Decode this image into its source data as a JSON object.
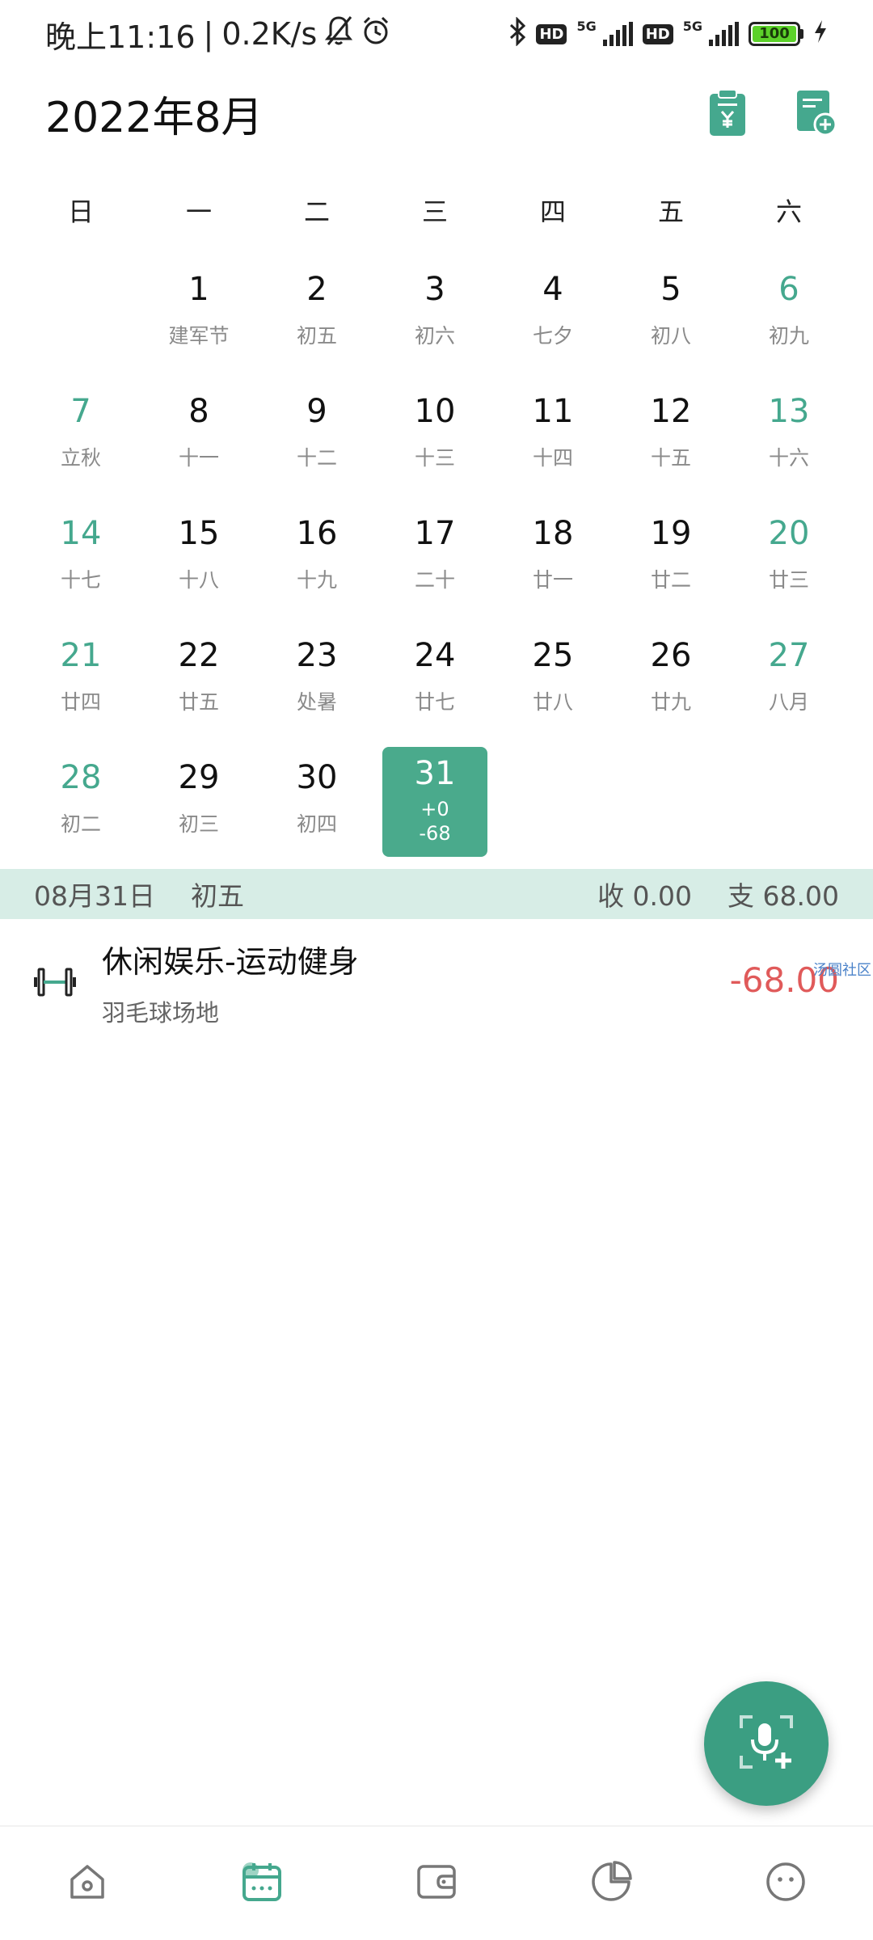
{
  "status_bar": {
    "time": "晚上11:16",
    "separator": "|",
    "net_speed": "0.2K/s",
    "battery": "100",
    "hd1": "HD",
    "hd2": "HD",
    "net1": "5G",
    "net2": "5G"
  },
  "header": {
    "title": "2022年8月",
    "icons": [
      "bill-clipboard-icon",
      "add-record-icon"
    ]
  },
  "weekdays": [
    "日",
    "一",
    "二",
    "三",
    "四",
    "五",
    "六"
  ],
  "calendar": {
    "leading_blank_days": 1,
    "days": [
      {
        "num": "1",
        "sub": "建军节"
      },
      {
        "num": "2",
        "sub": "初五"
      },
      {
        "num": "3",
        "sub": "初六"
      },
      {
        "num": "4",
        "sub": "七夕"
      },
      {
        "num": "5",
        "sub": "初八"
      },
      {
        "num": "6",
        "sub": "初九"
      },
      {
        "num": "7",
        "sub": "立秋"
      },
      {
        "num": "8",
        "sub": "十一"
      },
      {
        "num": "9",
        "sub": "十二"
      },
      {
        "num": "10",
        "sub": "十三"
      },
      {
        "num": "11",
        "sub": "十四"
      },
      {
        "num": "12",
        "sub": "十五"
      },
      {
        "num": "13",
        "sub": "十六"
      },
      {
        "num": "14",
        "sub": "十七"
      },
      {
        "num": "15",
        "sub": "十八"
      },
      {
        "num": "16",
        "sub": "十九"
      },
      {
        "num": "17",
        "sub": "二十"
      },
      {
        "num": "18",
        "sub": "廿一"
      },
      {
        "num": "19",
        "sub": "廿二"
      },
      {
        "num": "20",
        "sub": "廿三"
      },
      {
        "num": "21",
        "sub": "廿四"
      },
      {
        "num": "22",
        "sub": "廿五"
      },
      {
        "num": "23",
        "sub": "处暑"
      },
      {
        "num": "24",
        "sub": "廿七"
      },
      {
        "num": "25",
        "sub": "廿八"
      },
      {
        "num": "26",
        "sub": "廿九"
      },
      {
        "num": "27",
        "sub": "八月"
      },
      {
        "num": "28",
        "sub": "初二"
      },
      {
        "num": "29",
        "sub": "初三"
      },
      {
        "num": "30",
        "sub": "初四"
      },
      {
        "num": "31",
        "sub": "+0\n-68",
        "selected": true
      }
    ],
    "accent_color": "#4aaa8c",
    "weekend_color": "#45a88e"
  },
  "summary": {
    "date": "08月31日",
    "lunar": "初五",
    "income": "收 0.00",
    "expense": "支 68.00"
  },
  "records": [
    {
      "icon": "dumbbell-icon",
      "title": "休闲娱乐-运动健身",
      "note": "羽毛球场地",
      "amount": "-68.00",
      "amount_color": "#e05a5a"
    }
  ],
  "watermark": "汤圆社区",
  "fab": {
    "icon": "voice-add-icon"
  },
  "bottom_nav": [
    {
      "name": "home",
      "icon": "home-icon",
      "active": false
    },
    {
      "name": "calendar",
      "icon": "calendar-icon",
      "active": true
    },
    {
      "name": "wallet",
      "icon": "wallet-icon",
      "active": false
    },
    {
      "name": "chart",
      "icon": "pie-chart-icon",
      "active": false
    },
    {
      "name": "profile",
      "icon": "smiley-face-icon",
      "active": false
    }
  ]
}
